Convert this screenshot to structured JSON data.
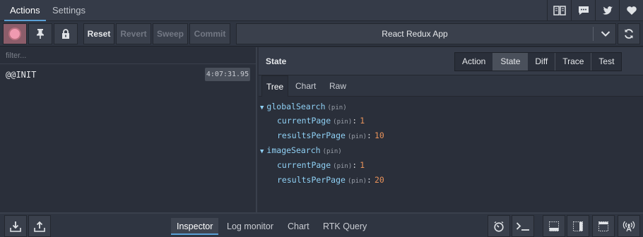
{
  "top_tabs": {
    "actions": "Actions",
    "settings": "Settings"
  },
  "top_icons": [
    "docs-icon",
    "feedback-icon",
    "twitter-icon",
    "heart-icon"
  ],
  "toolbar": {
    "reset": "Reset",
    "revert": "Revert",
    "sweep": "Sweep",
    "commit": "Commit",
    "instance_select": "React Redux App"
  },
  "filter": {
    "placeholder": "filter..."
  },
  "actions": [
    {
      "name": "@@INIT",
      "time": "4:07:31.95"
    }
  ],
  "state_panel": {
    "title": "State",
    "modes": [
      "Action",
      "State",
      "Diff",
      "Trace",
      "Test"
    ],
    "active_mode": "State",
    "sub_tabs": [
      "Tree",
      "Chart",
      "Raw"
    ],
    "active_sub_tab": "Tree"
  },
  "tree": {
    "pin_label": "(pin)",
    "global_search": {
      "key": "globalSearch",
      "current_page_key": "currentPage",
      "current_page_value": "1",
      "results_per_page_key": "resultsPerPage",
      "results_per_page_value": "10"
    },
    "image_search": {
      "key": "imageSearch",
      "current_page_key": "currentPage",
      "current_page_value": "1",
      "results_per_page_key": "resultsPerPage",
      "results_per_page_value": "20"
    }
  },
  "bottom_tabs": {
    "inspector": "Inspector",
    "log_monitor": "Log monitor",
    "chart": "Chart",
    "rtk_query": "RTK Query"
  },
  "colors": {
    "accent": "#5aa0d6",
    "key": "#8fd0f4",
    "number": "#e8925a",
    "record": "#f09ab0"
  }
}
